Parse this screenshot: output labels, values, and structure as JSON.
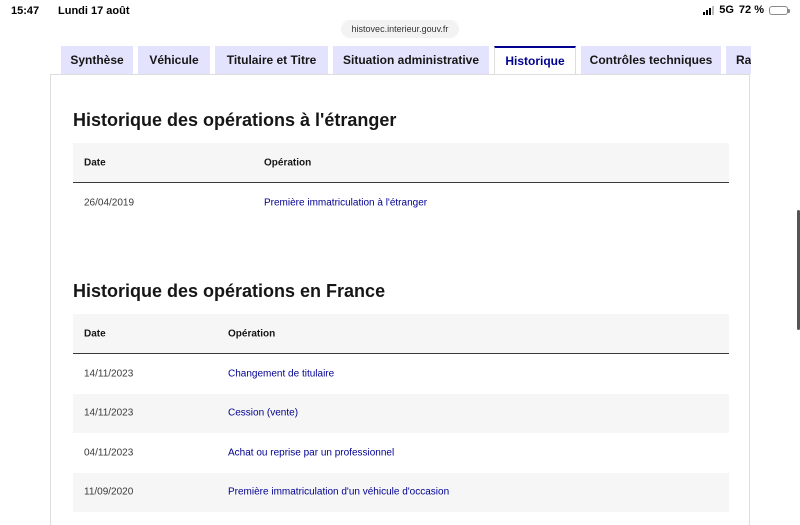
{
  "status": {
    "time": "15:47",
    "date": "Lundi 17 août",
    "network": "5G",
    "battery": "72 %"
  },
  "browser": {
    "url": "histovec.interieur.gouv.fr"
  },
  "tabs": [
    {
      "label": "Synthèse",
      "active": false
    },
    {
      "label": "Véhicule",
      "active": false
    },
    {
      "label": "Titulaire et Titre",
      "active": false
    },
    {
      "label": "Situation administrative",
      "active": false
    },
    {
      "label": "Historique",
      "active": true
    },
    {
      "label": "Contrôles techniques",
      "active": false
    },
    {
      "label": "Rapport",
      "active": false
    }
  ],
  "foreign": {
    "title": "Historique des opérations à l'étranger",
    "columns": [
      "Date",
      "Opération"
    ],
    "rows": [
      {
        "date": "26/04/2019",
        "operation": "Première immatriculation à l'étranger"
      }
    ]
  },
  "france": {
    "title": "Historique des opérations en France",
    "columns": [
      "Date",
      "Opération"
    ],
    "rows": [
      {
        "date": "14/11/2023",
        "operation": "Changement de titulaire"
      },
      {
        "date": "14/11/2023",
        "operation": "Cession (vente)"
      },
      {
        "date": "04/11/2023",
        "operation": "Achat ou reprise par un professionnel"
      },
      {
        "date": "11/09/2020",
        "operation": "Première immatriculation d'un véhicule d'occasion"
      }
    ]
  },
  "colors": {
    "accent": "#000091",
    "tab_bg": "#e3e3fd",
    "row_alt": "#f6f6f6"
  }
}
